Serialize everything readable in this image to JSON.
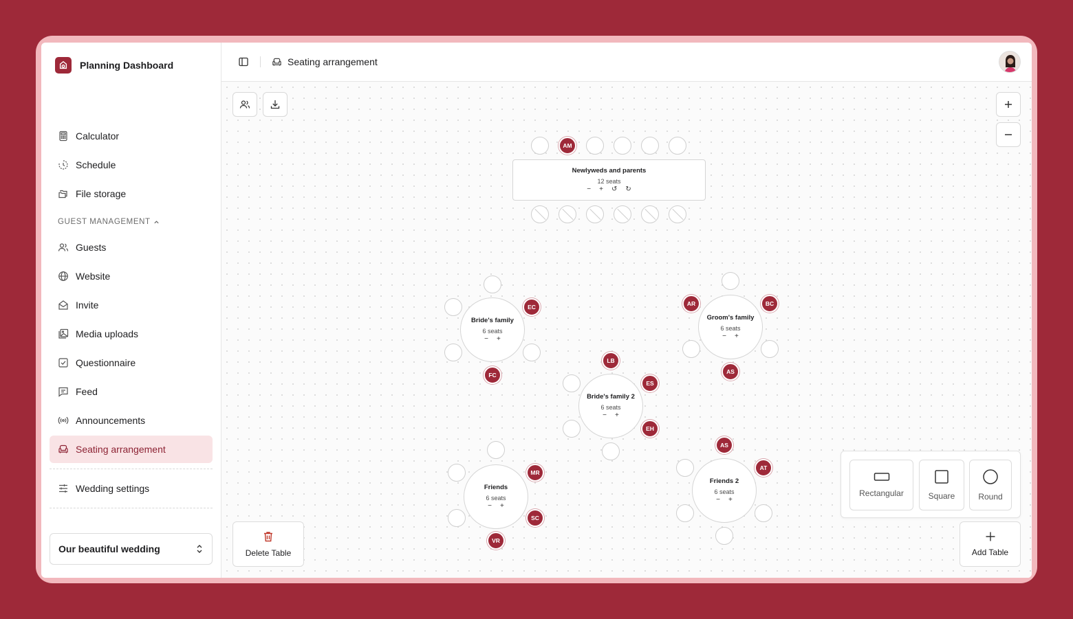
{
  "brand": {
    "name": "Planning Dashboard"
  },
  "sidebar": {
    "items": [
      {
        "label": "Calculator",
        "icon": "calculator-icon"
      },
      {
        "label": "Schedule",
        "icon": "clock-icon"
      },
      {
        "label": "File storage",
        "icon": "folders-icon"
      }
    ],
    "section_label": "GUEST MANAGEMENT",
    "guest_items": [
      {
        "label": "Guests",
        "icon": "users-icon"
      },
      {
        "label": "Website",
        "icon": "globe-icon"
      },
      {
        "label": "Invite",
        "icon": "envelope-open-icon"
      },
      {
        "label": "Media uploads",
        "icon": "images-icon"
      },
      {
        "label": "Questionnaire",
        "icon": "checkbox-icon"
      },
      {
        "label": "Feed",
        "icon": "message-icon"
      },
      {
        "label": "Announcements",
        "icon": "broadcast-icon"
      },
      {
        "label": "Seating arrangement",
        "icon": "armchair-icon",
        "active": true
      }
    ],
    "settings_label": "Wedding settings",
    "wedding_select": "Our beautiful wedding"
  },
  "header": {
    "title": "Seating arrangement"
  },
  "tables": [
    {
      "name": "Newlyweds and parents",
      "seats_label": "12 seats",
      "shape": "rectangular",
      "top_seats": [
        "",
        "AM",
        "",
        "",
        "",
        ""
      ],
      "bottom_seats": [
        "blocked",
        "blocked",
        "blocked",
        "blocked",
        "blocked",
        "blocked"
      ]
    },
    {
      "name": "Bride's family",
      "seats_label": "6 seats",
      "shape": "round",
      "guests": [
        "",
        "EC",
        "",
        "FC",
        "",
        ""
      ]
    },
    {
      "name": "Groom's family",
      "seats_label": "6 seats",
      "shape": "round",
      "guests": [
        "",
        "BC",
        "",
        "AS",
        "",
        "AR"
      ]
    },
    {
      "name": "Bride's family 2",
      "seats_label": "6 seats",
      "shape": "round",
      "guests": [
        "LB",
        "ES",
        "EH",
        "",
        "",
        ""
      ]
    },
    {
      "name": "Friends",
      "seats_label": "6 seats",
      "shape": "round",
      "guests": [
        "",
        "MR",
        "SC",
        "VR",
        "",
        ""
      ]
    },
    {
      "name": "Friends 2",
      "seats_label": "6 seats",
      "shape": "round",
      "guests": [
        "AS",
        "AT",
        "",
        "",
        "",
        ""
      ]
    }
  ],
  "table_controls": {
    "minus": "−",
    "plus": "+",
    "rotate_left": "↺",
    "rotate_right": "↻"
  },
  "shapes": {
    "rectangular": "Rectangular",
    "square": "Square",
    "round": "Round"
  },
  "actions": {
    "delete": "Delete Table",
    "add": "Add Table"
  },
  "colors": {
    "accent": "#9e2939",
    "background": "#9e2939",
    "frame": "#f2b8bd",
    "active_bg": "#f9e3e5"
  }
}
